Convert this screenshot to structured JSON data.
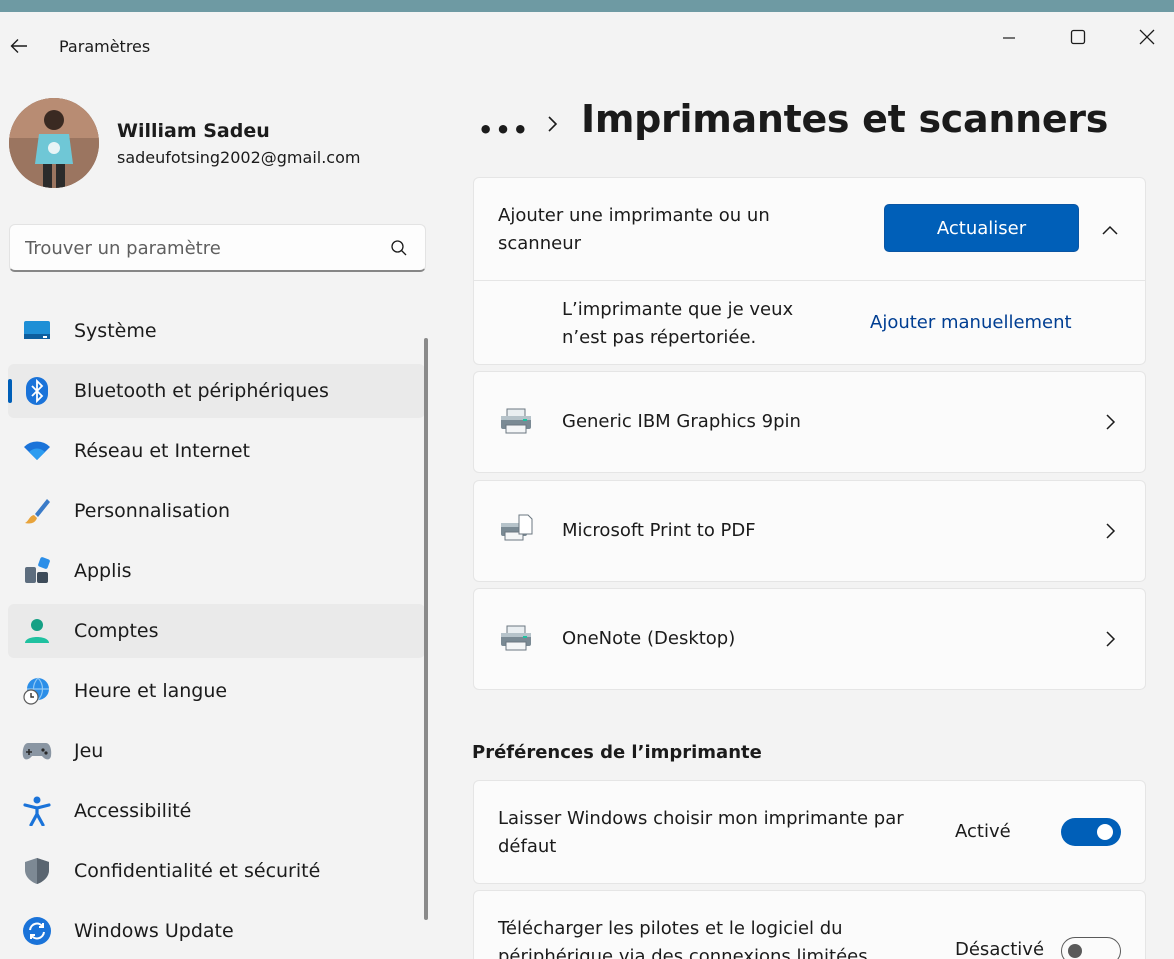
{
  "window": {
    "title": "Paramètres"
  },
  "profile": {
    "name": "William Sadeu",
    "email": "sadeufotsing2002@gmail.com"
  },
  "search": {
    "placeholder": "Trouver un paramètre"
  },
  "nav": {
    "items": [
      {
        "label": "Système",
        "icon": "system-icon"
      },
      {
        "label": "Bluetooth et périphériques",
        "icon": "bluetooth-icon",
        "selected": true
      },
      {
        "label": "Réseau et Internet",
        "icon": "wifi-icon"
      },
      {
        "label": "Personnalisation",
        "icon": "brush-icon"
      },
      {
        "label": "Applis",
        "icon": "apps-icon"
      },
      {
        "label": "Comptes",
        "icon": "account-icon",
        "hover": true
      },
      {
        "label": "Heure et langue",
        "icon": "globe-clock-icon"
      },
      {
        "label": "Jeu",
        "icon": "gamepad-icon"
      },
      {
        "label": "Accessibilité",
        "icon": "accessibility-icon"
      },
      {
        "label": "Confidentialité et sécurité",
        "icon": "shield-icon"
      },
      {
        "label": "Windows Update",
        "icon": "update-icon"
      }
    ]
  },
  "breadcrumb": {
    "more": "•••"
  },
  "page": {
    "title": "Imprimantes et scanners"
  },
  "add_printer": {
    "title_line1": "Ajouter une imprimante ou un",
    "title_line2": "scanneur",
    "refresh_label": "Actualiser",
    "not_listed_line1": "L’imprimante que je veux",
    "not_listed_line2": "n’est pas répertoriée.",
    "manual_link": "Ajouter manuellement"
  },
  "printers": [
    {
      "name": "Generic IBM Graphics 9pin",
      "icon": "printer-icon"
    },
    {
      "name": "Microsoft Print to PDF",
      "icon": "pdf-printer-icon"
    },
    {
      "name": "OneNote (Desktop)",
      "icon": "printer-icon"
    }
  ],
  "preferences": {
    "header": "Préférences de l’imprimante",
    "items": [
      {
        "line1": "Laisser Windows choisir mon imprimante par",
        "line2": "défaut",
        "state_label": "Activé",
        "on": true
      },
      {
        "line1": "Télécharger les pilotes et le logiciel du",
        "line2": "périphérique via des connexions limitées",
        "state_label": "Désactivé",
        "on": false
      }
    ]
  },
  "colors": {
    "accent": "#005fb8",
    "link": "#003e92",
    "background": "#f3f3f3",
    "card": "#fbfbfb"
  }
}
